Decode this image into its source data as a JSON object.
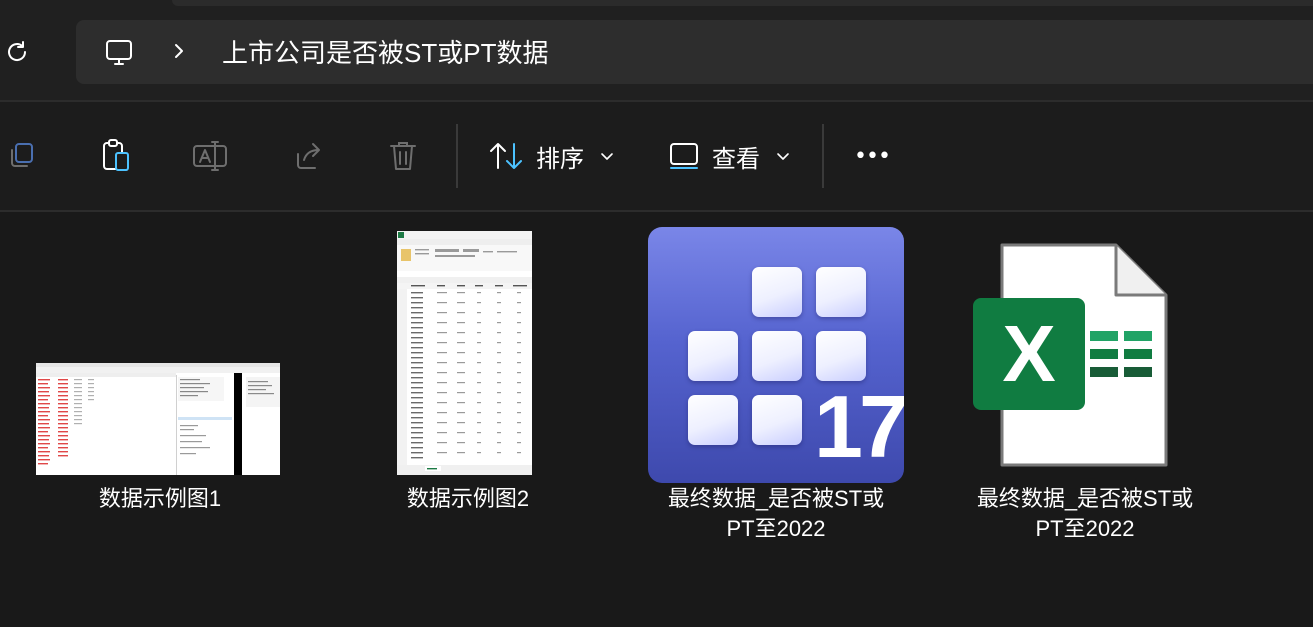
{
  "address_bar": {
    "path_segment": "上市公司是否被ST或PT数据"
  },
  "toolbar": {
    "buttons": [
      {
        "name": "copy-icon"
      },
      {
        "name": "paste-icon"
      },
      {
        "name": "rename-icon"
      },
      {
        "name": "share-icon"
      },
      {
        "name": "delete-icon"
      }
    ],
    "sort_label": "排序",
    "view_label": "查看",
    "more_label": "•••"
  },
  "files": [
    {
      "name_line1": "数据示例图1",
      "name_line2": "",
      "type": "image"
    },
    {
      "name_line1": "数据示例图2",
      "name_line2": "",
      "type": "image"
    },
    {
      "name_line1": "最终数据_是否被ST或",
      "name_line2": "PT至2022",
      "type": "stata",
      "icon_number": "17"
    },
    {
      "name_line1": "最终数据_是否被ST或",
      "name_line2": "PT至2022",
      "type": "excel",
      "icon_letter": "X"
    }
  ],
  "colors": {
    "background": "#191919",
    "accent_blue": "#4cc2ff",
    "excel_green": "#107c41",
    "stata_blue": "#5563cf"
  }
}
